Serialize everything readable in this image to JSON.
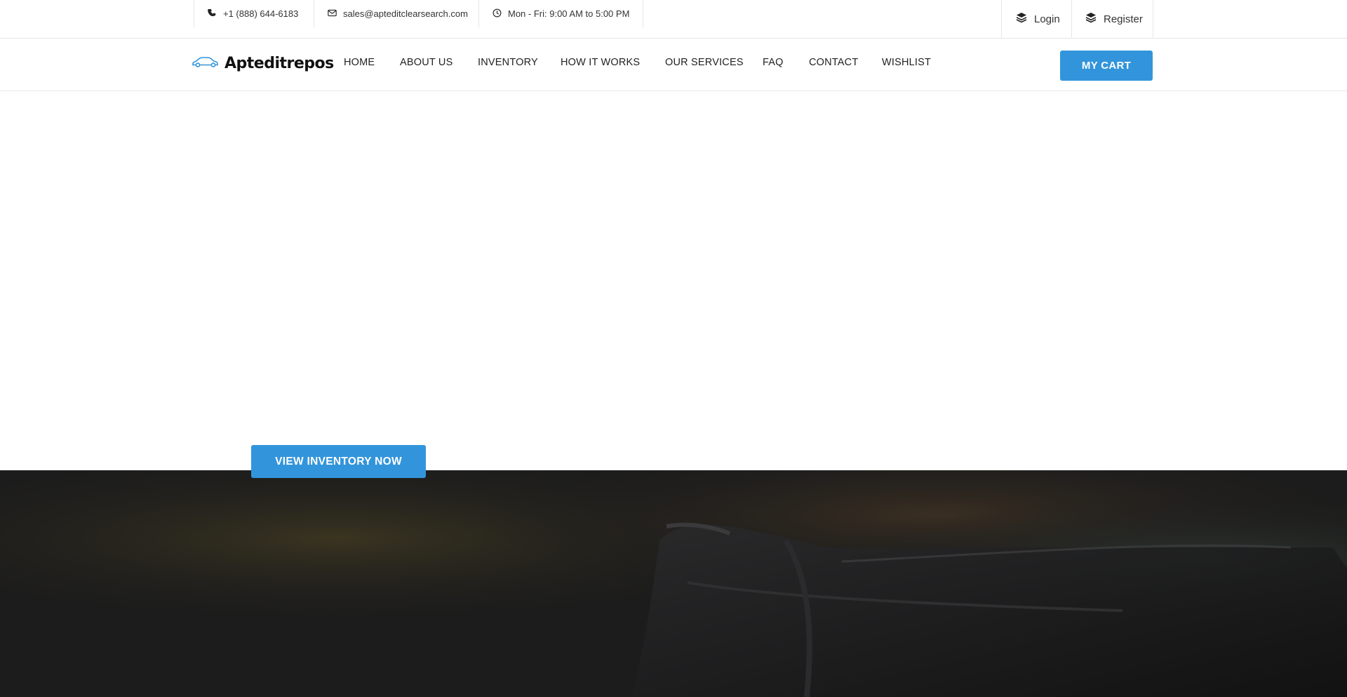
{
  "topbar": {
    "phone": "+1 (888) 644-6183",
    "email": "sales@apteditclearsearch.com",
    "hours": "Mon - Fri: 9:00 AM to 5:00 PM",
    "login_label": "Login",
    "register_label": "Register"
  },
  "brand": {
    "name": "Apteditrepos"
  },
  "nav": {
    "items": [
      "HOME",
      "ABOUT US",
      "INVENTORY",
      "HOW IT WORKS",
      "OUR SERVICES",
      "FAQ",
      "CONTACT",
      "WISHLIST"
    ],
    "cart_label": "MY CART"
  },
  "hero": {
    "cta_label": "VIEW INVENTORY NOW"
  },
  "colors": {
    "accent": "#3295db",
    "logo_icon": "#3295db",
    "dark_overlay": "#1c1c1c"
  },
  "icons": {
    "phone": "phone-icon",
    "email": "envelope-icon",
    "hours": "clock-icon",
    "login": "layers-icon",
    "register": "layers-icon",
    "logo": "car-icon"
  }
}
